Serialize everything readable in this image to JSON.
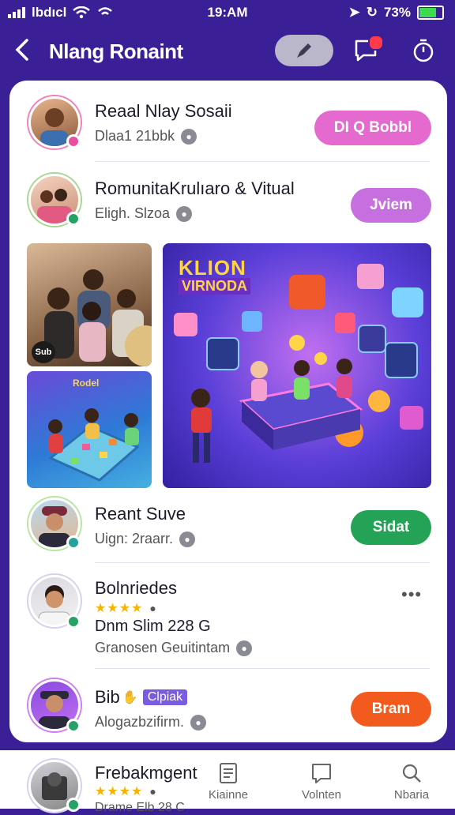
{
  "status_bar": {
    "carrier": "lbdıcl",
    "time": "19:AM",
    "battery": "73%"
  },
  "header": {
    "title": "Nlang Ronaint"
  },
  "contacts": [
    {
      "name": "Reaal Nlay Sosaii",
      "sub": "Dlaa1 2​1bbk",
      "action": "DI Q Bobbl",
      "action_color": "#e46ad0"
    },
    {
      "name": "RomunitaKrulıaro & Vitual",
      "sub": "Eligh. Slzoa",
      "action": "Jviem",
      "action_color": "#c86fe0"
    },
    {
      "name": "Reant Suve",
      "sub": "Uign: 2raarr.",
      "action": "Sidat",
      "action_color": "#24a356"
    },
    {
      "name": "Bolnriedes",
      "detail": "Dnm Slim 228 G",
      "sub": "Granosen Geuitintam"
    },
    {
      "name": "Bib",
      "tag": "Clpiak",
      "sub": "Alogazbzifirm.",
      "action": "Bram",
      "action_color": "#f25a1e"
    },
    {
      "name": "Frebakmgent",
      "sub": "Drame Elb 28 C"
    }
  ],
  "media": {
    "tile1_caption": "Sub",
    "tile2_title": "Rodel",
    "tile3_title": "KLION",
    "tile3_subtitle": "VIRNODA"
  },
  "bottom_nav": [
    {
      "label": "Kiainne"
    },
    {
      "label": "Volnten"
    },
    {
      "label": "Nbaria"
    }
  ]
}
